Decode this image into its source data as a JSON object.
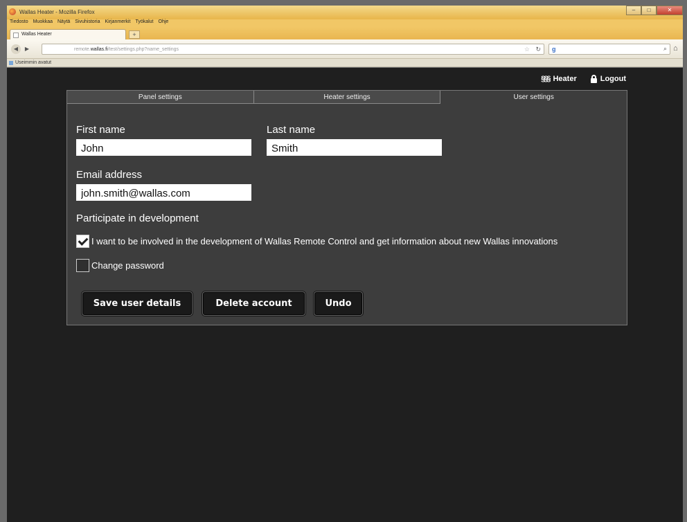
{
  "browser": {
    "window_title": "Wallas Heater - Mozilla Firefox",
    "menu": [
      "Tiedosto",
      "Muokkaa",
      "Näytä",
      "Sivuhistoria",
      "Kirjanmerkit",
      "Työkalut",
      "Ohje"
    ],
    "tab_title": "Wallas Heater",
    "url_prefix": "remote.",
    "url_domain": "wallas.fi",
    "url_path": "/test/settings.php?name_settings",
    "bookmarks_label": "Useimmin avatut"
  },
  "header": {
    "heater_label": "Heater",
    "logout_label": "Logout",
    "heater_icon": "heater-icon",
    "logout_icon": "lock-icon"
  },
  "tabs": [
    "Panel settings",
    "Heater settings",
    "User settings"
  ],
  "form": {
    "first_name_label": "First name",
    "first_name_value": "John",
    "last_name_label": "Last name",
    "last_name_value": "Smith",
    "email_label": "Email address",
    "email_value": "john.smith@wallas.com",
    "participate_heading": "Participate in development",
    "involve_label": "I want to be involved in the development of Wallas Remote Control and get information about new Wallas innovations",
    "involve_checked": true,
    "change_password_label": "Change password",
    "change_password_checked": false
  },
  "buttons": {
    "save": "Save user details",
    "delete": "Delete account",
    "undo": "Undo"
  }
}
